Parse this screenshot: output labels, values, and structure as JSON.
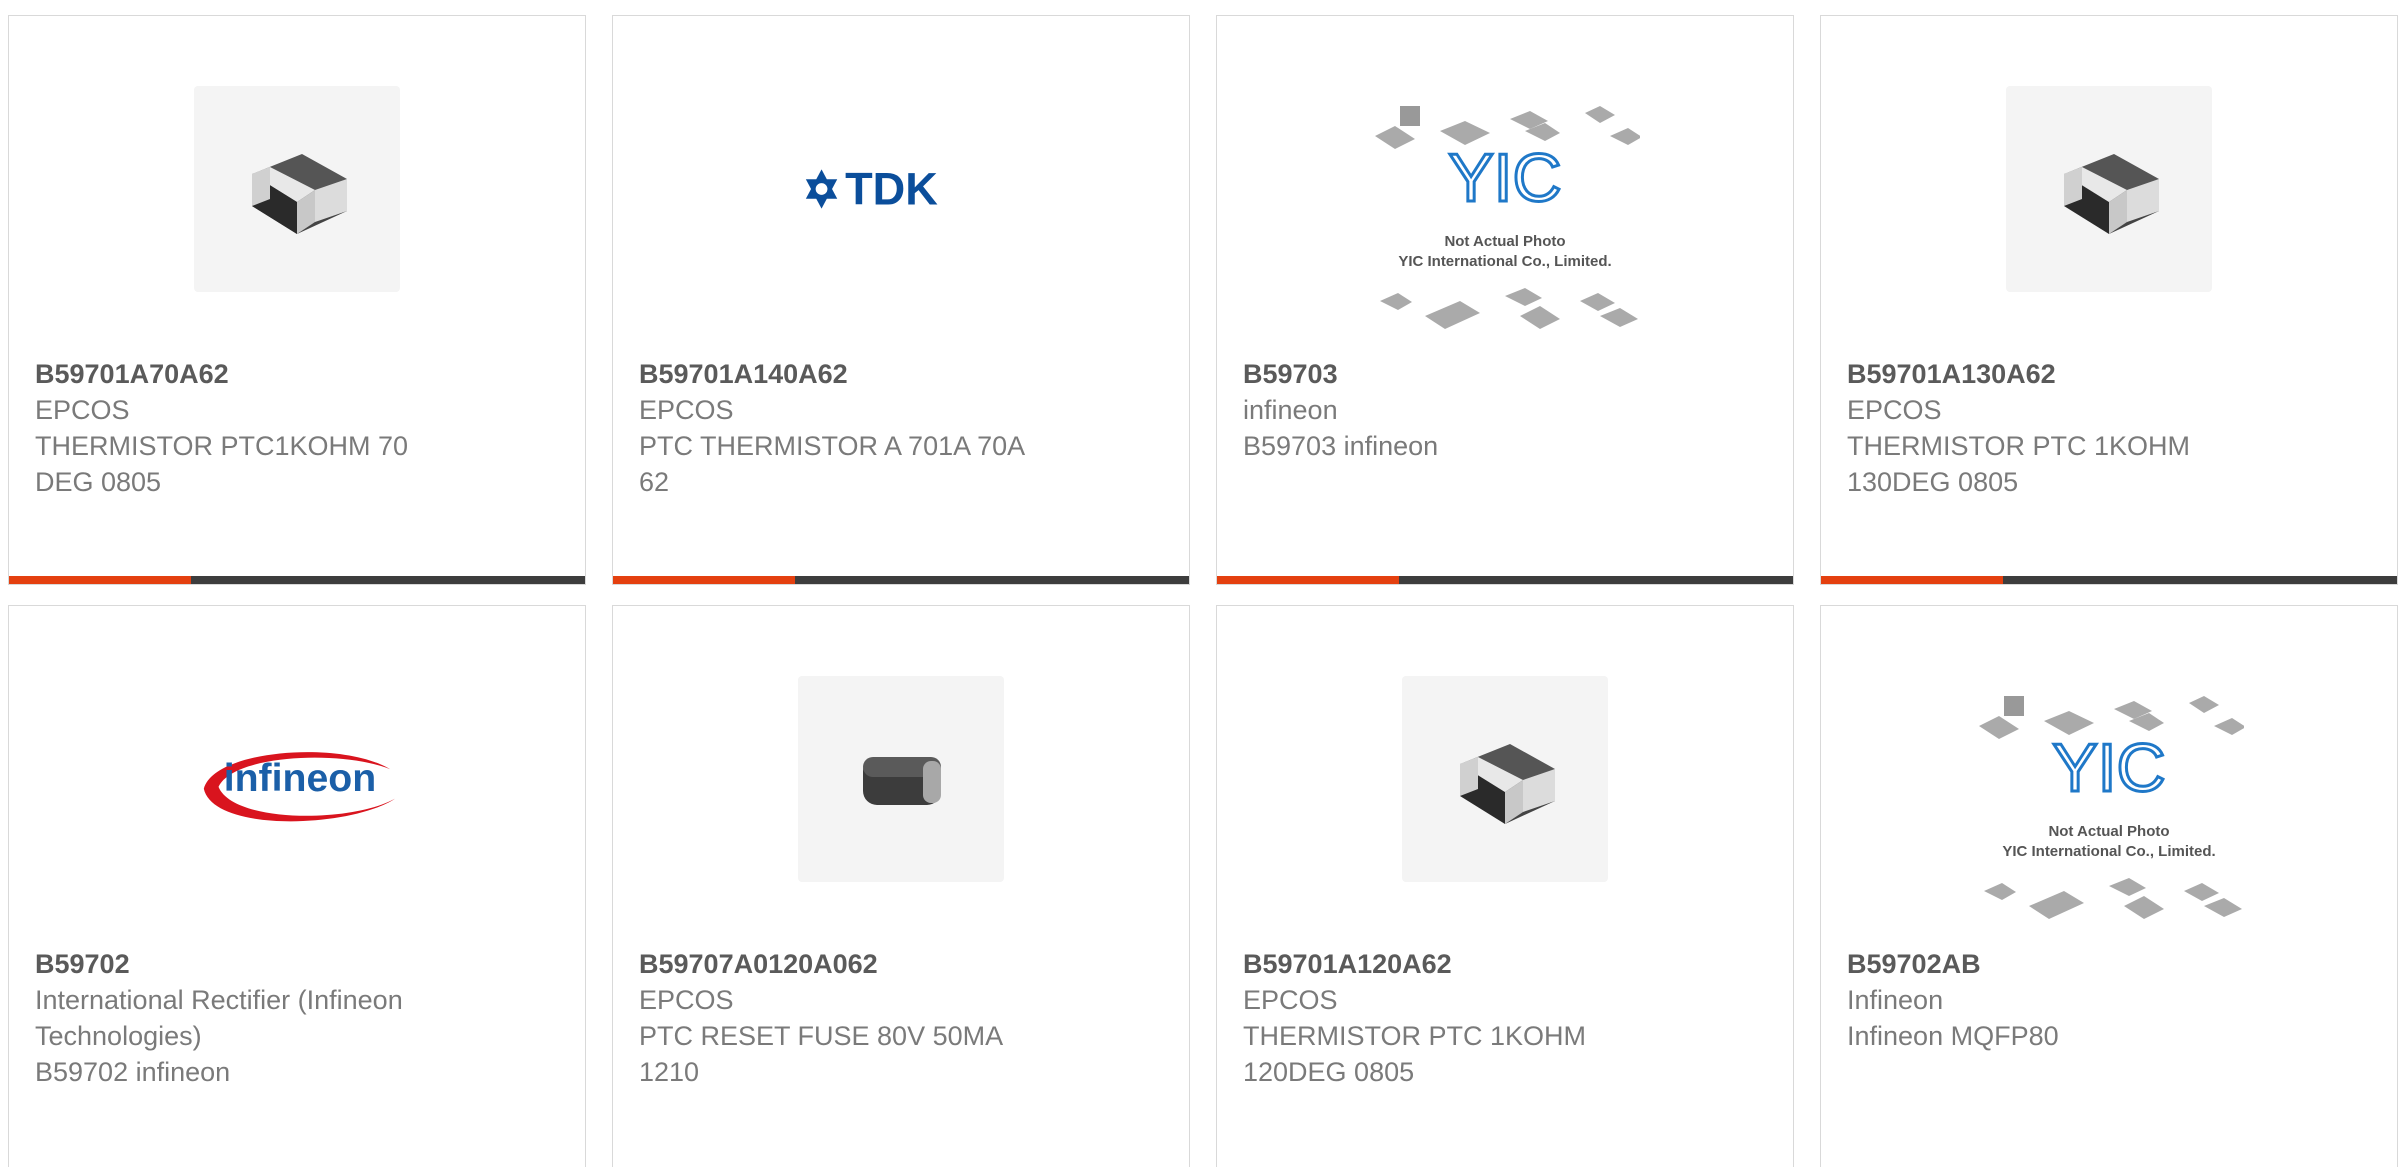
{
  "products": [
    {
      "part": "B59701A70A62",
      "maker": "EPCOS",
      "desc": "THERMISTOR PTC1KOHM 70 DEG 0805",
      "image": "smd-chip-photo"
    },
    {
      "part": "B59701A140A62",
      "maker": "EPCOS",
      "desc": "PTC THERMISTOR A 701A 70A 62",
      "image": "tdk-logo",
      "logo_text": "TDK"
    },
    {
      "part": "B59703",
      "maker": "infineon",
      "desc": "B59703 infineon",
      "image": "yic-placeholder",
      "logo_text": "YIC",
      "caption1": "Not Actual Photo",
      "caption2": "YIC International Co., Limited."
    },
    {
      "part": "B59701A130A62",
      "maker": "EPCOS",
      "desc": "THERMISTOR PTC 1KOHM 130DEG 0805",
      "image": "smd-chip-photo"
    },
    {
      "part": "B59702",
      "maker": "International Rectifier (Infineon Technologies)",
      "desc": "B59702 infineon",
      "image": "infineon-logo",
      "logo_text": "infineon"
    },
    {
      "part": "B59707A0120A062",
      "maker": "EPCOS",
      "desc": "PTC RESET FUSE 80V 50MA 1210",
      "image": "smd-fuse-photo"
    },
    {
      "part": "B59701A120A62",
      "maker": "EPCOS",
      "desc": "THERMISTOR PTC 1KOHM 120DEG 0805",
      "image": "smd-chip-photo"
    },
    {
      "part": "B59702AB",
      "maker": "Infineon",
      "desc": "Infineon MQFP80",
      "image": "yic-placeholder",
      "logo_text": "YIC",
      "caption1": "Not Actual Photo",
      "caption2": "YIC International Co., Limited."
    }
  ],
  "colors": {
    "accent": "#e4400f",
    "bar": "#3d3d3d",
    "tdk_blue": "#0b4e9b",
    "infineon_blue": "#1b5fa8",
    "infineon_red": "#d9141e",
    "yic_blue": "#1f78c8"
  }
}
